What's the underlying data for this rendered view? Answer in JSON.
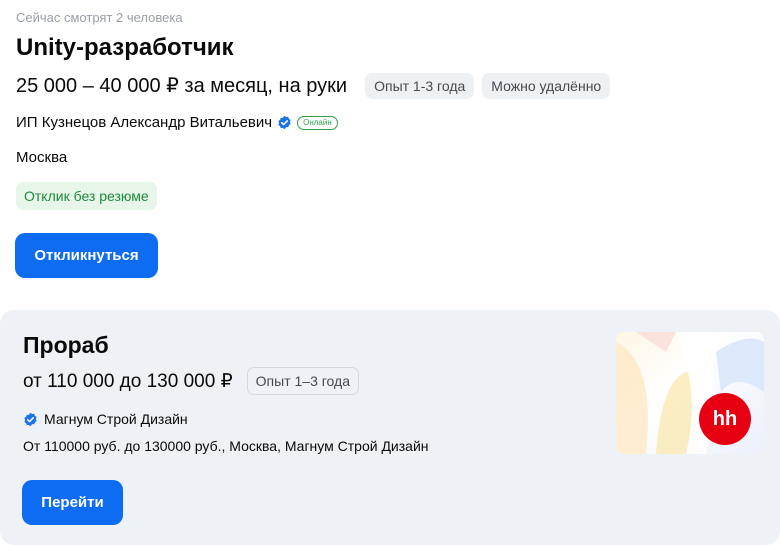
{
  "vacancy1": {
    "watching_now": "Сейчас смотрят 2 человека",
    "title": "Unity-разработчик",
    "salary": "25 000 – 40 000 ₽ за месяц, на руки",
    "experience": "Опыт 1-3 года",
    "remote": "Можно удалённо",
    "company": "ИП Кузнецов Александр Витальевич",
    "online_badge": "Онлайн",
    "city": "Москва",
    "no_resume": "Отклик без резюме",
    "apply_label": "Откликнуться",
    "accent": "#0d6cf2"
  },
  "vacancy2": {
    "title": "Прораб",
    "salary": "от 110 000  до 130 000 ₽",
    "experience": "Опыт 1–3 года",
    "company": "Магнум Строй Дизайн",
    "description": "От 110000 руб. до 130000 руб., Москва, Магнум Строй Дизайн",
    "go_label": "Перейти",
    "logo_text": "hh",
    "logo_color": "#e60012"
  },
  "icons": {
    "verified": "verified-check-icon"
  }
}
